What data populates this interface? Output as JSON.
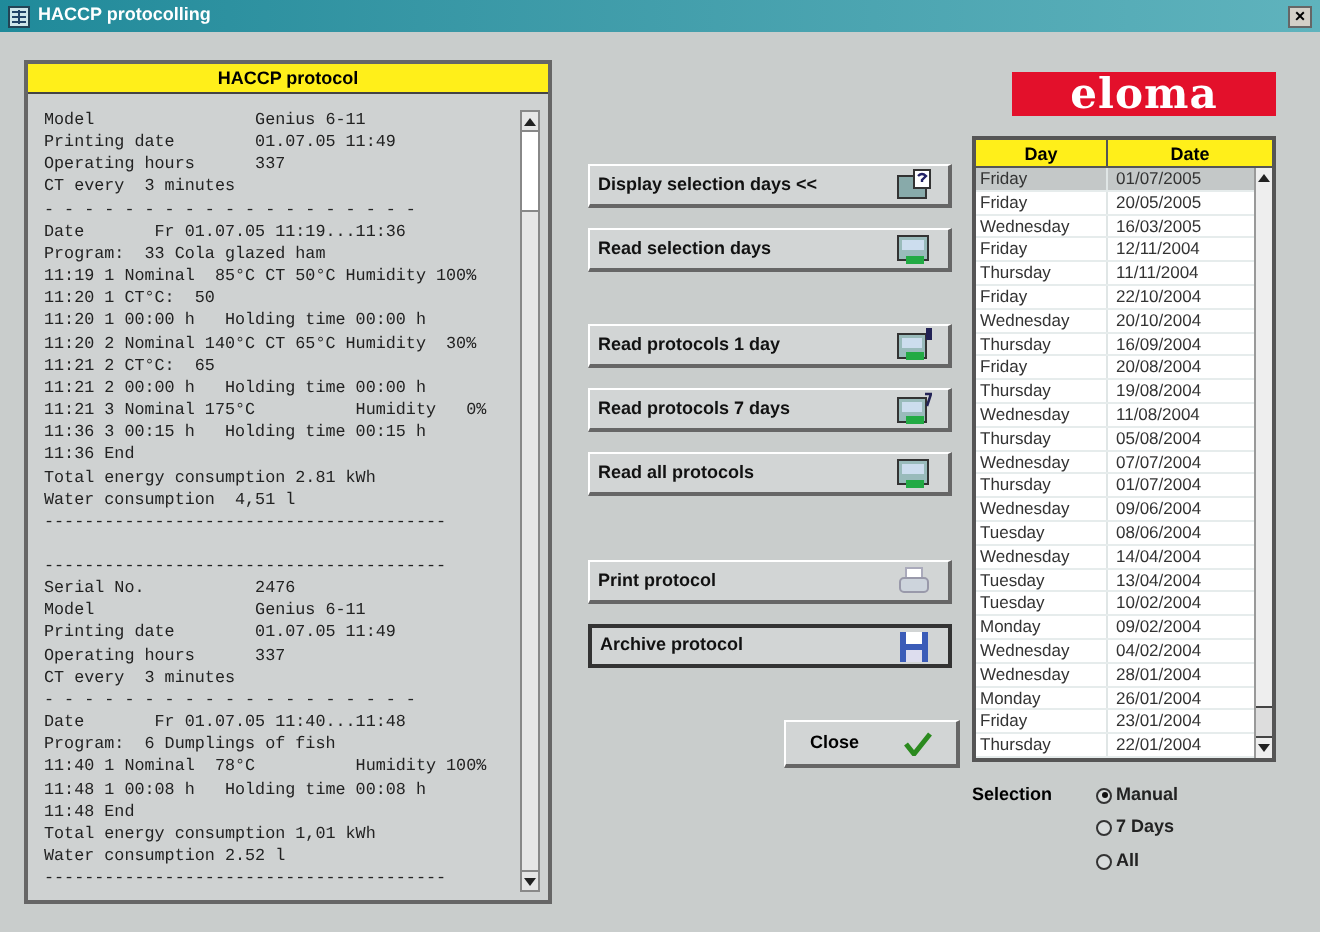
{
  "window": {
    "title": "HACCP protocolling",
    "close": "×"
  },
  "protocol_panel": {
    "title": "HACCP protocol",
    "blocks": [
      [
        "Model                Genius 6-11",
        "Printing date        01.07.05 11:49",
        "Operating hours      337",
        "CT every  3 minutes",
        "- - - - - - - - - - - - - - - - - - -",
        "Date       Fr 01.07.05 11:19...11:36",
        "Program:  33 Cola glazed ham",
        "11:19 1 Nominal  85°C CT 50°C Humidity 100%",
        "11:20 1 CT°C:  50",
        "11:20 1 00:00 h   Holding time 00:00 h",
        "11:20 2 Nominal 140°C CT 65°C Humidity  30%",
        "11:21 2 CT°C:  65",
        "11:21 2 00:00 h   Holding time 00:00 h",
        "11:21 3 Nominal 175°C          Humidity   0%",
        "11:36 3 00:15 h   Holding time 00:15 h",
        "11:36 End",
        "Total energy consumption 2.81 kWh",
        "Water consumption  4,51 l",
        "----------------------------------------"
      ],
      [
        "----------------------------------------",
        "Serial No.           2476",
        "Model                Genius 6-11",
        "Printing date        01.07.05 11:49",
        "Operating hours      337",
        "CT every  3 minutes",
        "- - - - - - - - - - - - - - - - - - -",
        "Date       Fr 01.07.05 11:40...11:48",
        "Program:  6 Dumplings of fish",
        "11:40 1 Nominal  78°C          Humidity 100%",
        "11:48 1 00:08 h   Holding time 00:08 h",
        "11:48 End",
        "Total energy consumption 1,01 kWh",
        "Water consumption 2.52 l",
        "----------------------------------------"
      ]
    ]
  },
  "button_groups": [
    [
      {
        "label": "Display selection days <<",
        "kind": "query",
        "focused": false
      },
      {
        "label": "Read selection days",
        "kind": "read",
        "focused": false
      }
    ],
    [
      {
        "label": "Read protocols 1 day",
        "kind": "one",
        "focused": false
      },
      {
        "label": "Read protocols 7 days",
        "kind": "seven",
        "focused": false
      },
      {
        "label": "Read all protocols",
        "kind": "read",
        "focused": false
      }
    ],
    [
      {
        "label": "Print protocol",
        "kind": "print",
        "focused": false
      },
      {
        "label": "Archive protocol",
        "kind": "archive",
        "focused": true
      }
    ]
  ],
  "close_button": {
    "label": "Close"
  },
  "logo": "eloma",
  "days_table": {
    "columns": [
      "Day",
      "Date"
    ],
    "rows": [
      {
        "day": "Friday",
        "date": "01/07/2005",
        "selected": true
      },
      {
        "day": "Friday",
        "date": "20/05/2005",
        "selected": false
      },
      {
        "day": "Wednesday",
        "date": "16/03/2005",
        "selected": false
      },
      {
        "day": "Friday",
        "date": "12/11/2004",
        "selected": false
      },
      {
        "day": "Thursday",
        "date": "11/11/2004",
        "selected": false
      },
      {
        "day": "Friday",
        "date": "22/10/2004",
        "selected": false
      },
      {
        "day": "Wednesday",
        "date": "20/10/2004",
        "selected": false
      },
      {
        "day": "Thursday",
        "date": "16/09/2004",
        "selected": false
      },
      {
        "day": "Friday",
        "date": "20/08/2004",
        "selected": false
      },
      {
        "day": "Thursday",
        "date": "19/08/2004",
        "selected": false
      },
      {
        "day": "Wednesday",
        "date": "11/08/2004",
        "selected": false
      },
      {
        "day": "Thursday",
        "date": "05/08/2004",
        "selected": false
      },
      {
        "day": "Wednesday",
        "date": "07/07/2004",
        "selected": false
      },
      {
        "day": "Thursday",
        "date": "01/07/2004",
        "selected": false
      },
      {
        "day": "Wednesday",
        "date": "09/06/2004",
        "selected": false
      },
      {
        "day": "Tuesday",
        "date": "08/06/2004",
        "selected": false
      },
      {
        "day": "Wednesday",
        "date": "14/04/2004",
        "selected": false
      },
      {
        "day": "Tuesday",
        "date": "13/04/2004",
        "selected": false
      },
      {
        "day": "Tuesday",
        "date": "10/02/2004",
        "selected": false
      },
      {
        "day": "Monday",
        "date": "09/02/2004",
        "selected": false
      },
      {
        "day": "Wednesday",
        "date": "04/02/2004",
        "selected": false
      },
      {
        "day": "Wednesday",
        "date": "28/01/2004",
        "selected": false
      },
      {
        "day": "Monday",
        "date": "26/01/2004",
        "selected": false
      },
      {
        "day": "Friday",
        "date": "23/01/2004",
        "selected": false
      },
      {
        "day": "Thursday",
        "date": "22/01/2004",
        "selected": false
      }
    ]
  },
  "selection": {
    "label": "Selection",
    "options": [
      {
        "label": "Manual",
        "selected": true
      },
      {
        "label": "7 Days",
        "selected": false
      },
      {
        "label": "All",
        "selected": false
      }
    ]
  }
}
